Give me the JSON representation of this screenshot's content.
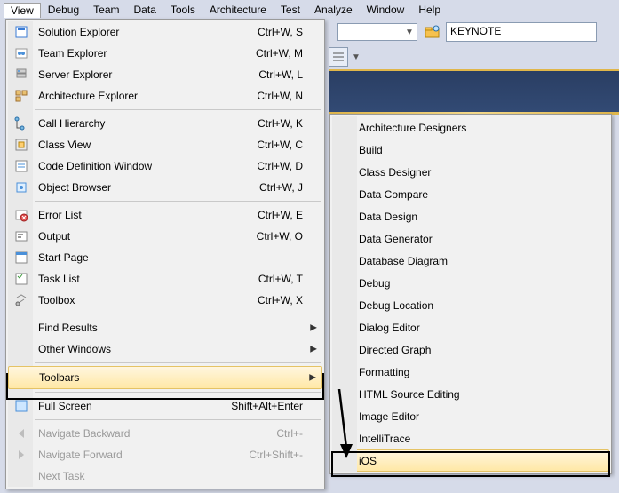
{
  "menubar": {
    "items": [
      "View",
      "Debug",
      "Team",
      "Data",
      "Tools",
      "Architecture",
      "Test",
      "Analyze",
      "Window",
      "Help"
    ],
    "open_index": 0
  },
  "toolbar": {
    "search_value": "KEYNOTE"
  },
  "view_menu": {
    "rows": [
      {
        "icon": "solution-explorer-icon",
        "label": "Solution Explorer",
        "shortcut": "Ctrl+W, S"
      },
      {
        "icon": "team-explorer-icon",
        "label": "Team Explorer",
        "shortcut": "Ctrl+W, M"
      },
      {
        "icon": "server-explorer-icon",
        "label": "Server Explorer",
        "shortcut": "Ctrl+W, L"
      },
      {
        "icon": "architecture-explorer-icon",
        "label": "Architecture Explorer",
        "shortcut": "Ctrl+W, N"
      },
      {
        "sep": true
      },
      {
        "icon": "call-hierarchy-icon",
        "label": "Call Hierarchy",
        "shortcut": "Ctrl+W, K"
      },
      {
        "icon": "class-view-icon",
        "label": "Class View",
        "shortcut": "Ctrl+W, C"
      },
      {
        "icon": "code-definition-icon",
        "label": "Code Definition Window",
        "shortcut": "Ctrl+W, D"
      },
      {
        "icon": "object-browser-icon",
        "label": "Object Browser",
        "shortcut": "Ctrl+W, J"
      },
      {
        "sep": true
      },
      {
        "icon": "error-list-icon",
        "label": "Error List",
        "shortcut": "Ctrl+W, E"
      },
      {
        "icon": "output-icon",
        "label": "Output",
        "shortcut": "Ctrl+W, O"
      },
      {
        "icon": "start-page-icon",
        "label": "Start Page",
        "shortcut": ""
      },
      {
        "icon": "task-list-icon",
        "label": "Task List",
        "shortcut": "Ctrl+W, T"
      },
      {
        "icon": "toolbox-icon",
        "label": "Toolbox",
        "shortcut": "Ctrl+W, X"
      },
      {
        "sep": true
      },
      {
        "icon": "",
        "label": "Find Results",
        "shortcut": "",
        "submenu": true
      },
      {
        "icon": "",
        "label": "Other Windows",
        "shortcut": "",
        "submenu": true
      },
      {
        "sep": true
      },
      {
        "icon": "",
        "label": "Toolbars",
        "shortcut": "",
        "submenu": true,
        "highlight": true
      },
      {
        "sep": true
      },
      {
        "icon": "full-screen-icon",
        "label": "Full Screen",
        "shortcut": "Shift+Alt+Enter"
      },
      {
        "sep": true
      },
      {
        "icon": "nav-back-icon",
        "label": "Navigate Backward",
        "shortcut": "Ctrl+-",
        "disabled": true
      },
      {
        "icon": "nav-forward-icon",
        "label": "Navigate Forward",
        "shortcut": "Ctrl+Shift+-",
        "disabled": true
      },
      {
        "icon": "",
        "label": "Next Task",
        "shortcut": "",
        "disabled": true
      }
    ]
  },
  "toolbars_submenu": {
    "items": [
      "Architecture Designers",
      "Build",
      "Class Designer",
      "Data Compare",
      "Data Design",
      "Data Generator",
      "Database Diagram",
      "Debug",
      "Debug Location",
      "Dialog Editor",
      "Directed Graph",
      "Formatting",
      "HTML Source Editing",
      "Image Editor",
      "IntelliTrace",
      "iOS"
    ],
    "highlight_index": 15
  }
}
